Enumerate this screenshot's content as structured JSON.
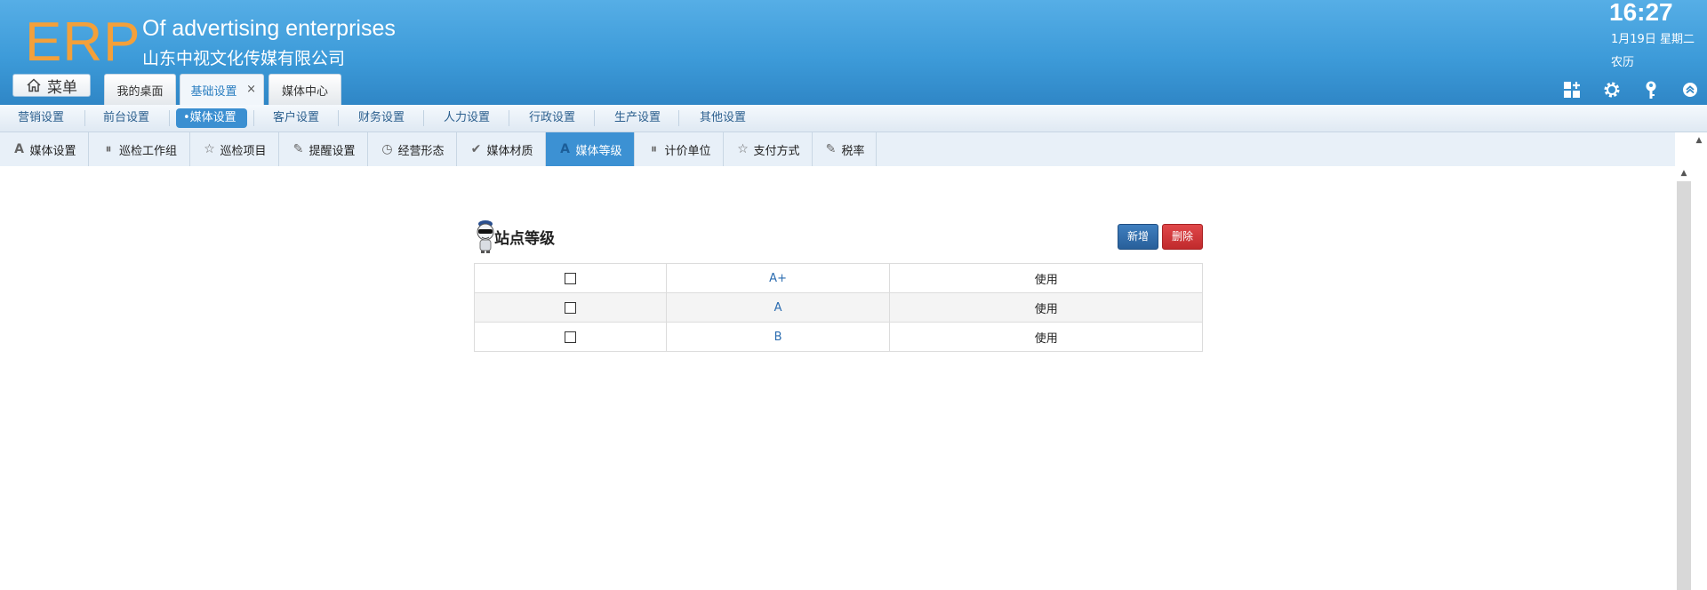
{
  "header": {
    "logo": "ERP",
    "company_en": "Of advertising enterprises",
    "company_cn": "山东中视文化传媒有限公司",
    "menu_label": "菜单",
    "tabs": [
      {
        "label": "我的桌面"
      },
      {
        "label": "基础设置",
        "active": true,
        "close": "×"
      },
      {
        "label": "媒体中心"
      }
    ],
    "time": "16:27",
    "date": "1月19日 星期二",
    "lunar": "农历",
    "icons": [
      "apps-icon",
      "gear-icon",
      "key-icon",
      "collapse-up-icon"
    ],
    "colors": {
      "header_bg": "#3d9bd9",
      "logo": "#f3a03a"
    }
  },
  "modules": [
    "营销设置",
    "前台设置",
    "•媒体设置",
    "客户设置",
    "财务设置",
    "人力设置",
    "行政设置",
    "生产设置",
    "其他设置"
  ],
  "active_module": "•媒体设置",
  "subtabs": [
    {
      "label": "媒体设置",
      "icon": "font-a-icon"
    },
    {
      "label": "巡检工作组",
      "icon": "pause-circle-icon"
    },
    {
      "label": "巡检项目",
      "icon": "star-icon"
    },
    {
      "label": "提醒设置",
      "icon": "pencil-icon"
    },
    {
      "label": "经营形态",
      "icon": "clock-icon"
    },
    {
      "label": "媒体材质",
      "icon": "check-icon"
    },
    {
      "label": "媒体等级",
      "icon": "font-a-icon",
      "active": true
    },
    {
      "label": "计价单位",
      "icon": "pause-circle-icon"
    },
    {
      "label": "支付方式",
      "icon": "star-icon"
    },
    {
      "label": "税率",
      "icon": "pencil-icon"
    }
  ],
  "panel": {
    "title": "站点等级",
    "add_label": "新增",
    "delete_label": "删除",
    "rows": [
      {
        "grade": "A+",
        "status": "使用"
      },
      {
        "grade": "A",
        "status": "使用"
      },
      {
        "grade": "B",
        "status": "使用"
      }
    ]
  }
}
